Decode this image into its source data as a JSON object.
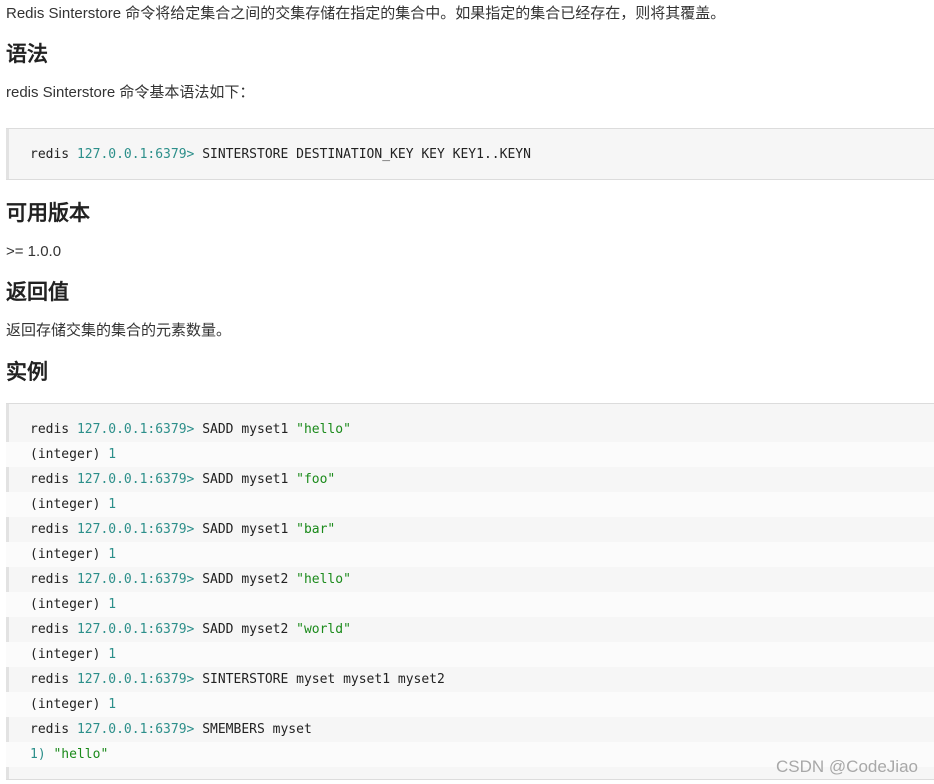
{
  "intro": "Redis Sinterstore 命令将给定集合之间的交集存储在指定的集合中。如果指定的集合已经存在，则将其覆盖。",
  "sections": {
    "syntax_heading": "语法",
    "syntax_text": "redis Sinterstore 命令基本语法如下：",
    "syntax_code": {
      "prompt": "redis",
      "host": "127.0.0.1:6379>",
      "command": " SINTERSTORE DESTINATION_KEY KEY KEY1..KEYN"
    },
    "version_heading": "可用版本",
    "version_text": ">= 1.0.0",
    "return_heading": "返回值",
    "return_text": "返回存储交集的集合的元素数量。",
    "example_heading": "实例"
  },
  "example_lines": [
    {
      "prompt": "redis",
      "host": "127.0.0.1:6379>",
      "cmd": " SADD myset1 ",
      "str": "\"hello\""
    },
    {
      "reply_label": "(integer)",
      "reply_value": " 1"
    },
    {
      "prompt": "redis",
      "host": "127.0.0.1:6379>",
      "cmd": " SADD myset1 ",
      "str": "\"foo\""
    },
    {
      "reply_label": "(integer)",
      "reply_value": " 1"
    },
    {
      "prompt": "redis",
      "host": "127.0.0.1:6379>",
      "cmd": " SADD myset1 ",
      "str": "\"bar\""
    },
    {
      "reply_label": "(integer)",
      "reply_value": " 1"
    },
    {
      "prompt": "redis",
      "host": "127.0.0.1:6379>",
      "cmd": " SADD myset2 ",
      "str": "\"hello\""
    },
    {
      "reply_label": "(integer)",
      "reply_value": " 1"
    },
    {
      "prompt": "redis",
      "host": "127.0.0.1:6379>",
      "cmd": " SADD myset2 ",
      "str": "\"world\""
    },
    {
      "reply_label": "(integer)",
      "reply_value": " 1"
    },
    {
      "prompt": "redis",
      "host": "127.0.0.1:6379>",
      "cmd": " SINTERSTORE myset myset1 myset2",
      "str": ""
    },
    {
      "reply_label": "(integer)",
      "reply_value": " 1"
    },
    {
      "prompt": "redis",
      "host": "127.0.0.1:6379>",
      "cmd": " SMEMBERS myset",
      "str": ""
    },
    {
      "list_index": "1)",
      "list_value": " \"hello\""
    }
  ],
  "watermark": "CSDN @CodeJiao",
  "colors": {
    "host": "#2c8f8a",
    "string": "#1a8a1a",
    "code_bg": "#f6f6f6"
  }
}
